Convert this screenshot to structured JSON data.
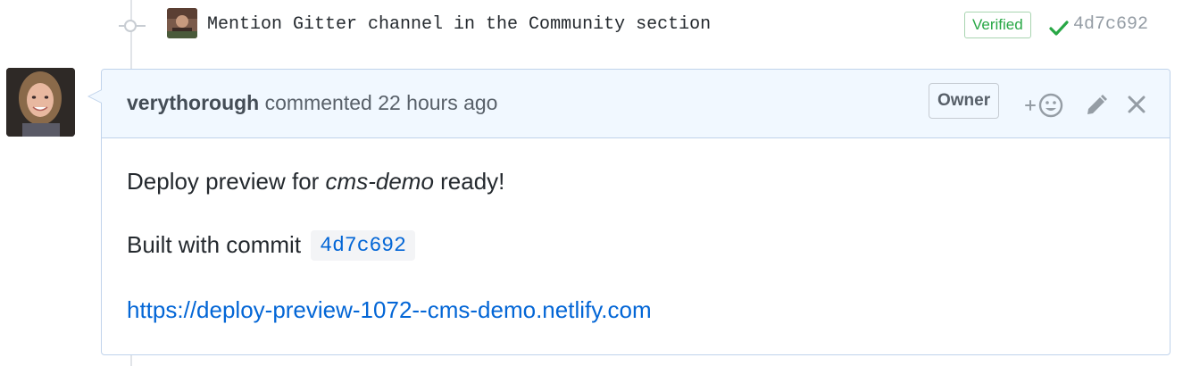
{
  "commit": {
    "message": "Mention Gitter channel in the Community section",
    "verified_label": "Verified",
    "sha": "4d7c692",
    "status_color": "#28a745"
  },
  "comment": {
    "author": "verythorough",
    "action": "commented",
    "time": "22 hours ago",
    "role_badge": "Owner",
    "icons": [
      "add-reaction-icon",
      "pencil-icon",
      "close-icon"
    ],
    "body": {
      "line1_prefix": "Deploy preview for ",
      "line1_emphasis": "cms-demo",
      "line1_suffix": " ready!",
      "line2_prefix": "Built with commit",
      "line2_commit": "4d7c692",
      "link_text": "https://deploy-preview-1072--cms-demo.netlify.com"
    }
  },
  "colors": {
    "link": "#0366d6",
    "header_bg": "#f1f8ff",
    "border": "#c0d3eb"
  }
}
